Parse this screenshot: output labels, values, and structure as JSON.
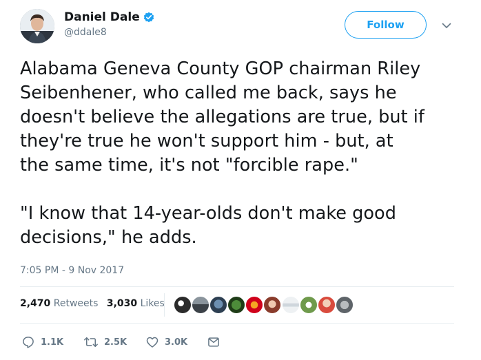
{
  "author": {
    "display_name": "Daniel Dale",
    "handle": "@ddale8",
    "verified": true
  },
  "follow_label": "Follow",
  "tweet": {
    "paragraph_1": "Alabama Geneva County GOP chairman Riley\nSeibenhener, who called me back, says he\ndoesn't believe the allegations are true, but if\nthey're true he won't support him - but, at\nthe same time, it's not \"forcible rape.\"",
    "paragraph_2": "\"I know that 14-year-olds don't make good\ndecisions,\" he adds.",
    "timestamp": "7:05 PM - 9 Nov 2017"
  },
  "stats": {
    "retweets_count": "2,470",
    "retweets_label": "Retweets",
    "likes_count": "3,030",
    "likes_label": "Likes"
  },
  "actions": {
    "reply_count": "1.1K",
    "retweet_count": "2.5K",
    "like_count": "3.0K"
  },
  "icons": {
    "verified": "verified-badge-icon",
    "menu": "chevron-down-icon",
    "reply": "reply-icon",
    "retweet": "retweet-icon",
    "like": "heart-icon",
    "message": "envelope-icon"
  },
  "colors": {
    "accent": "#1da1f2",
    "text": "#14171a",
    "secondary": "#657786",
    "divider": "#e6ecf0"
  }
}
